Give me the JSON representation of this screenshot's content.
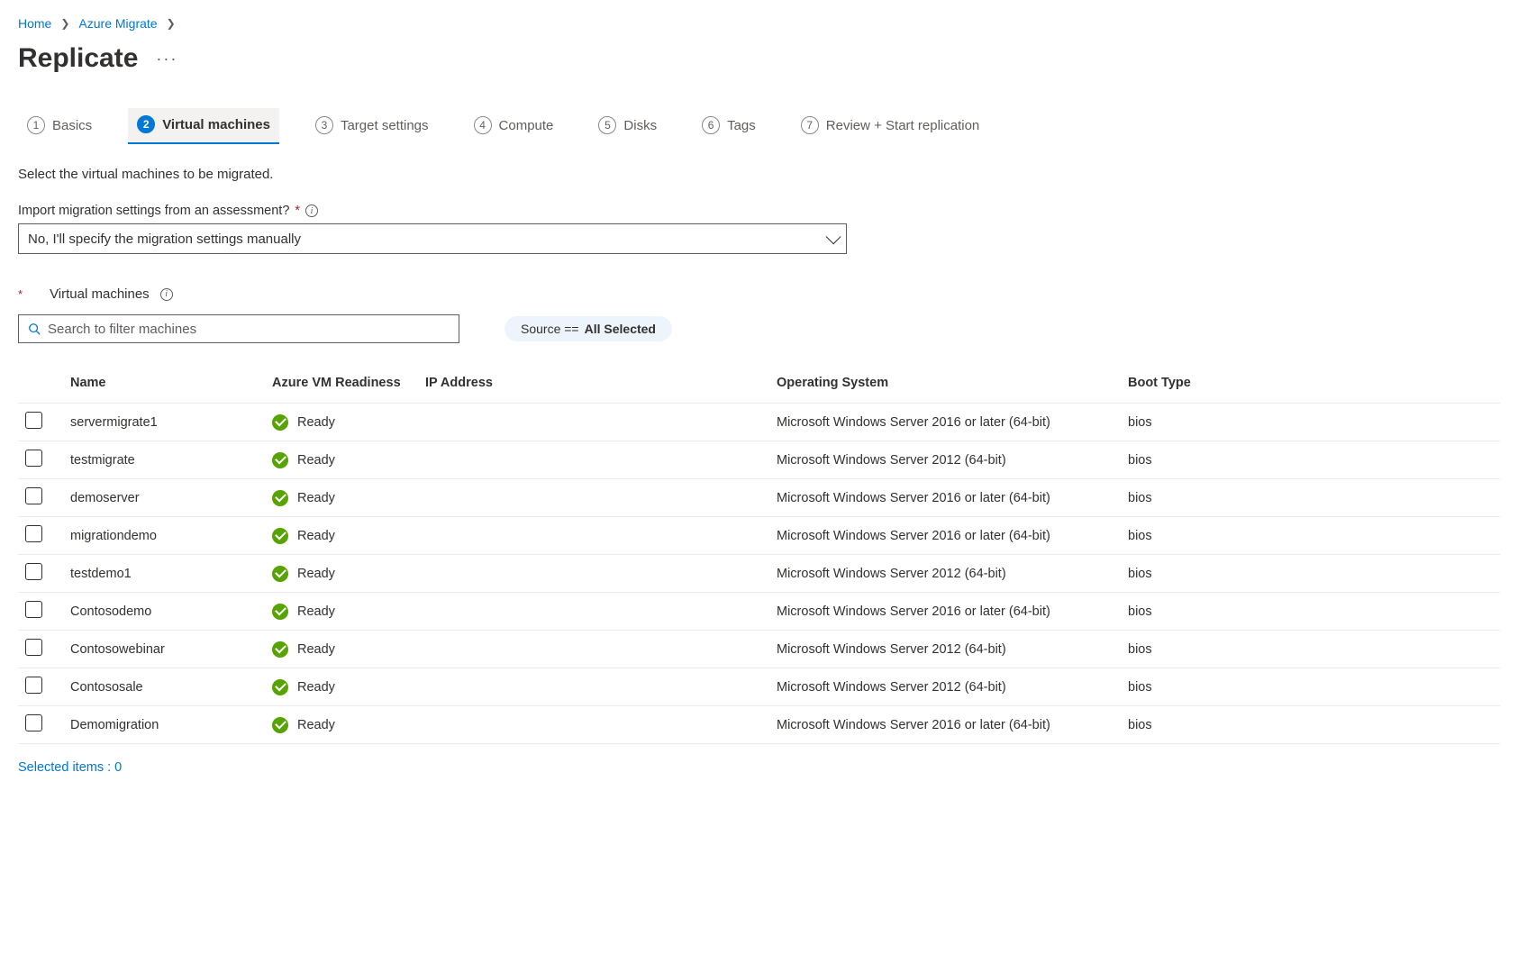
{
  "breadcrumb": {
    "items": [
      {
        "label": "Home"
      },
      {
        "label": "Azure Migrate"
      }
    ]
  },
  "page": {
    "title": "Replicate"
  },
  "tabs": [
    {
      "num": "1",
      "label": "Basics"
    },
    {
      "num": "2",
      "label": "Virtual machines"
    },
    {
      "num": "3",
      "label": "Target settings"
    },
    {
      "num": "4",
      "label": "Compute"
    },
    {
      "num": "5",
      "label": "Disks"
    },
    {
      "num": "6",
      "label": "Tags"
    },
    {
      "num": "7",
      "label": "Review + Start replication"
    }
  ],
  "instruction": "Select the virtual machines to be migrated.",
  "importField": {
    "label": "Import migration settings from an assessment?",
    "value": "No, I'll specify the migration settings manually"
  },
  "section": {
    "title": "Virtual machines"
  },
  "search": {
    "placeholder": "Search to filter machines"
  },
  "filter": {
    "key": "Source ==",
    "value": "All Selected"
  },
  "tableHeaders": {
    "name": "Name",
    "readiness": "Azure VM Readiness",
    "ip": "IP Address",
    "os": "Operating System",
    "boot": "Boot Type"
  },
  "rows": [
    {
      "name": "servermigrate1",
      "readiness": "Ready",
      "ip": "",
      "os": "Microsoft Windows Server 2016 or later (64-bit)",
      "boot": "bios"
    },
    {
      "name": "testmigrate",
      "readiness": "Ready",
      "ip": "",
      "os": "Microsoft Windows Server 2012 (64-bit)",
      "boot": "bios"
    },
    {
      "name": "demoserver",
      "readiness": "Ready",
      "ip": "",
      "os": "Microsoft Windows Server 2016 or later (64-bit)",
      "boot": "bios"
    },
    {
      "name": "migrationdemo",
      "readiness": "Ready",
      "ip": "",
      "os": "Microsoft Windows Server 2016 or later (64-bit)",
      "boot": "bios"
    },
    {
      "name": "testdemo1",
      "readiness": "Ready",
      "ip": "",
      "os": "Microsoft Windows Server 2012 (64-bit)",
      "boot": "bios"
    },
    {
      "name": "Contosodemo",
      "readiness": "Ready",
      "ip": "",
      "os": "Microsoft Windows Server 2016 or later (64-bit)",
      "boot": "bios"
    },
    {
      "name": "Contosowebinar",
      "readiness": "Ready",
      "ip": "",
      "os": "Microsoft Windows Server 2012 (64-bit)",
      "boot": "bios"
    },
    {
      "name": "Contososale",
      "readiness": "Ready",
      "ip": "",
      "os": "Microsoft Windows Server 2012 (64-bit)",
      "boot": "bios"
    },
    {
      "name": "Demomigration",
      "readiness": "Ready",
      "ip": "",
      "os": "Microsoft Windows Server 2016 or later (64-bit)",
      "boot": "bios"
    }
  ],
  "footer": {
    "selected": "Selected items : 0"
  }
}
